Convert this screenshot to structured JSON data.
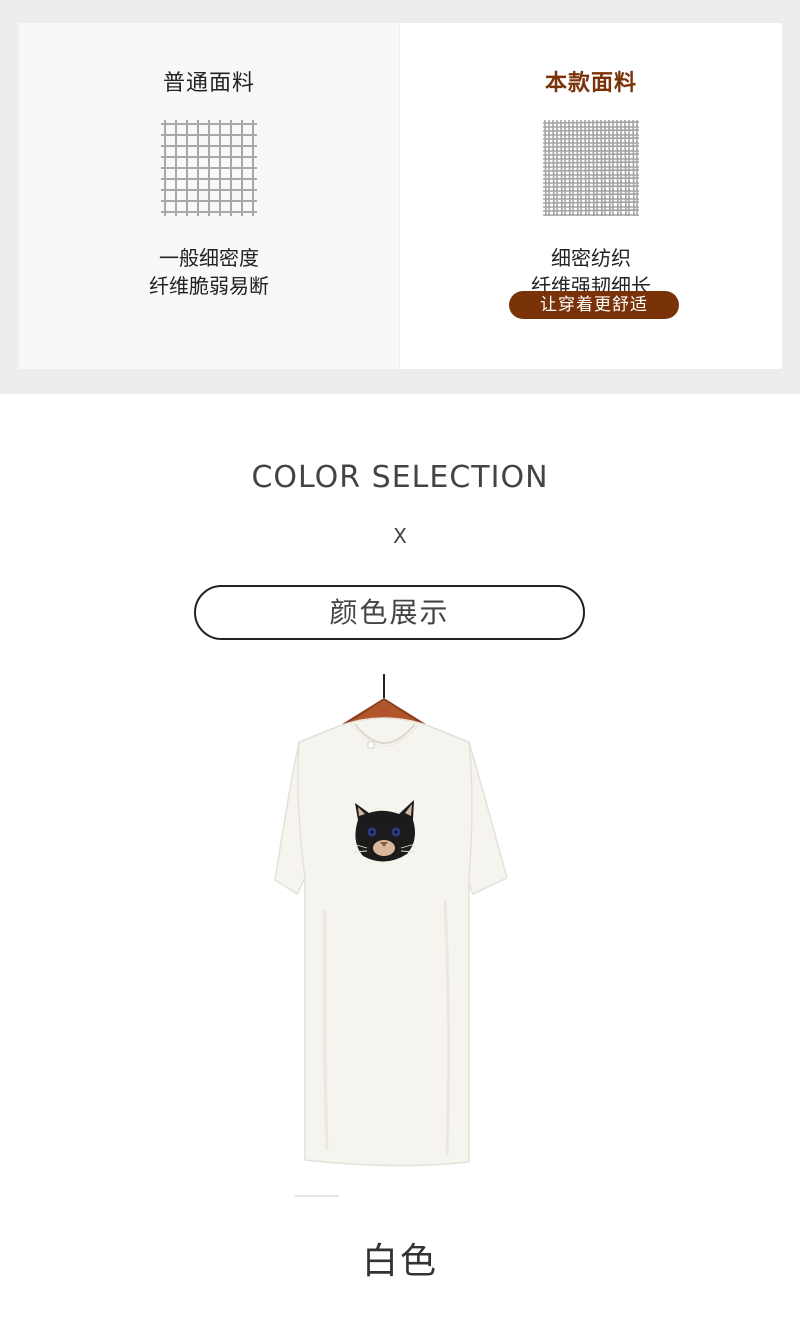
{
  "fabric_compare": {
    "normal": {
      "title": "普通面料",
      "desc_line1": "一般细密度",
      "desc_line2": "纤维脆弱易断"
    },
    "featured": {
      "title": "本款面料",
      "desc_line1": "细密纺织",
      "desc_line2": "纤维强韧细长",
      "badge": "让穿着更舒适"
    }
  },
  "color_section": {
    "heading": "COLOR SELECTION",
    "separator": "X",
    "display_label": "颜色展示"
  },
  "product": {
    "color_name": "白色"
  },
  "colors": {
    "accent_brown": "#7a3208",
    "band_gray": "#ededed",
    "shirt_white": "#f6f4ee"
  }
}
